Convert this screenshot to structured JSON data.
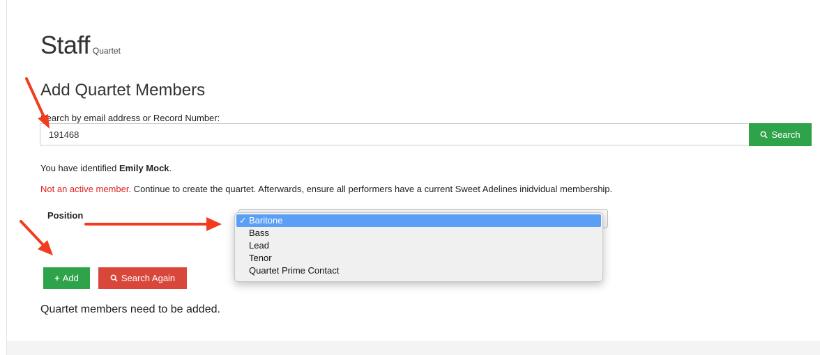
{
  "page": {
    "title": "Staff",
    "subtitle": "Quartet"
  },
  "section": {
    "title": "Add Quartet Members"
  },
  "search": {
    "label": "Search by email address or Record Number:",
    "value": "191468",
    "button_label": "Search",
    "button_icon": "search-icon"
  },
  "identified": {
    "prefix": "You have identified ",
    "name": "Emily Mock",
    "suffix": "."
  },
  "status": {
    "warning": "Not an active member.",
    "message": " Continue to create the quartet. Afterwards, ensure all performers have a current Sweet Adelines inidvidual membership."
  },
  "position": {
    "label": "Position",
    "selected": "Baritone",
    "options": [
      "Baritone",
      "Bass",
      "Lead",
      "Tenor",
      "Quartet Prime Contact"
    ]
  },
  "actions": {
    "add_label": "Add",
    "search_again_label": "Search Again"
  },
  "members_message": "Quartet members need to be added.",
  "colors": {
    "success": "#2ea34a",
    "danger": "#d9473b",
    "warning_text": "#e02020",
    "selection": "#5a9ef5",
    "annotation_arrow": "#f23c1f"
  }
}
